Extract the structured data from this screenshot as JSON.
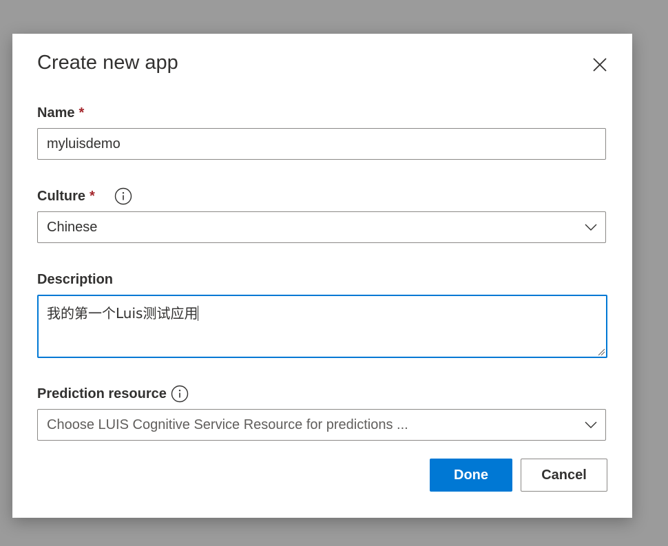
{
  "dialog": {
    "title": "Create new app",
    "close_icon": "close-icon"
  },
  "fields": {
    "name": {
      "label": "Name",
      "required_mark": "*",
      "value": "myluisdemo"
    },
    "culture": {
      "label": "Culture",
      "required_mark": "*",
      "info_icon": "info-icon",
      "value": "Chinese",
      "chevron_icon": "chevron-down-icon"
    },
    "description": {
      "label": "Description",
      "value": "我的第一个Luis测试应用"
    },
    "prediction_resource": {
      "label": "Prediction resource",
      "info_icon": "info-icon",
      "placeholder": "Choose LUIS Cognitive Service Resource for predictions ...",
      "chevron_icon": "chevron-down-icon"
    }
  },
  "buttons": {
    "done_label": "Done",
    "cancel_label": "Cancel"
  },
  "colors": {
    "primary": "#0078d4",
    "required": "#a4262c",
    "text": "#323130",
    "border": "#8a8886",
    "backdrop": "#9b9b9b"
  }
}
